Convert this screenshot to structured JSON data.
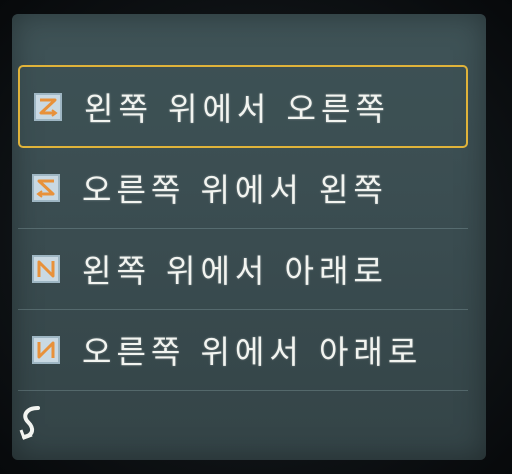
{
  "menu": {
    "items": [
      {
        "label": "왼쪽 위에서 오른쪽",
        "icon": "z-order-icon",
        "selected": true
      },
      {
        "label": "오른쪽 위에서 왼쪽",
        "icon": "s-order-icon",
        "selected": false
      },
      {
        "label": "왼쪽 위에서 아래로",
        "icon": "reverse-n-order-icon",
        "selected": false
      },
      {
        "label": "오른쪽 위에서 아래로",
        "icon": "n-order-icon",
        "selected": false
      }
    ]
  },
  "colors": {
    "screen_bg": "#3c4f53",
    "highlight_border": "#e0b33a",
    "icon_stroke": "#e8913a",
    "text": "#f2f4f0"
  },
  "back": {
    "icon": "back-arrow-icon"
  }
}
